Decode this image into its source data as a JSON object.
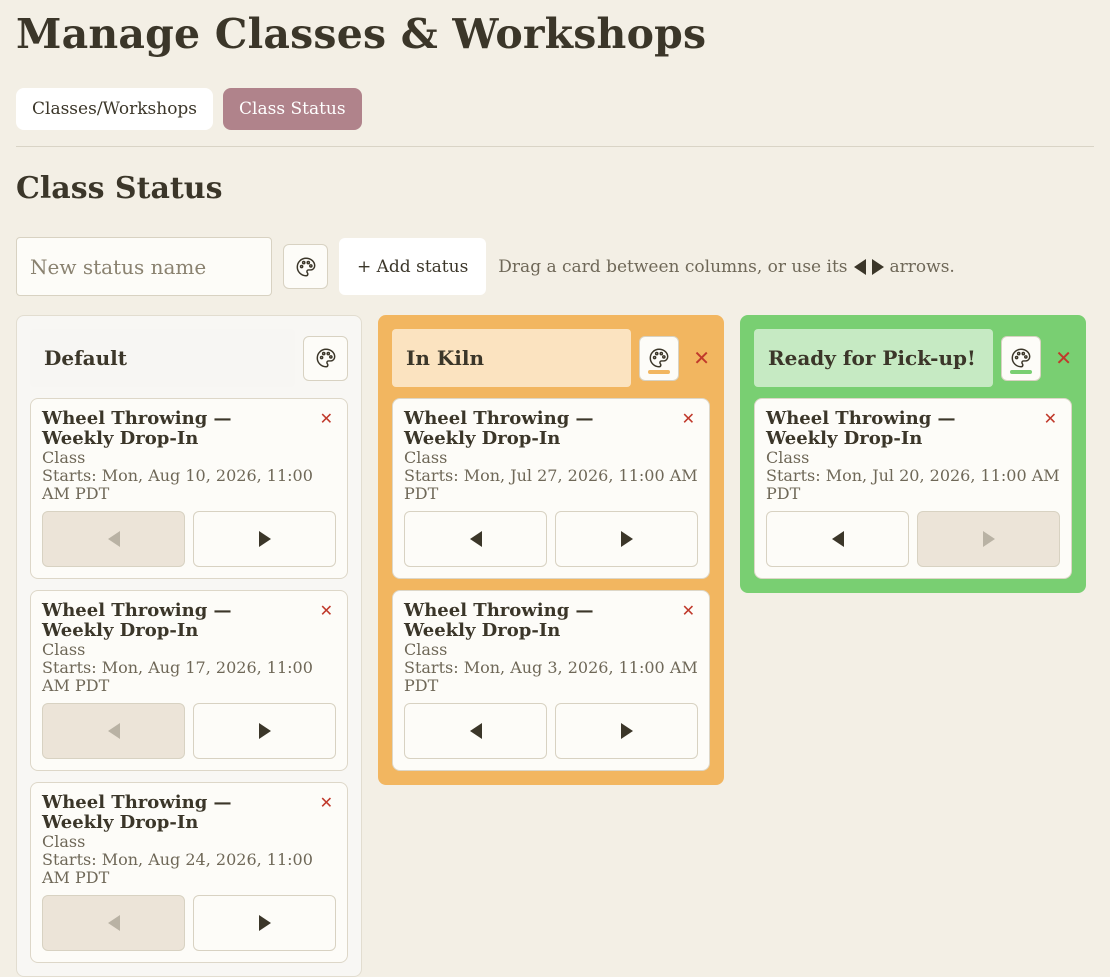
{
  "page": {
    "title": "Manage Classes & Workshops",
    "section_title": "Class Status"
  },
  "tabs": [
    {
      "label": "Classes/Workshops",
      "active": false
    },
    {
      "label": "Class Status",
      "active": true
    }
  ],
  "add_status": {
    "placeholder": "New status name",
    "button_label": "+ Add status",
    "hint_before": "Drag a card between columns, or use its",
    "hint_after": "arrows."
  },
  "columns": [
    {
      "title": "Default",
      "color": "#f8f7f4",
      "title_bg": "#f7f6f3",
      "swatch": "",
      "cards": [
        {
          "title": "Wheel Throwing — Weekly Drop-In",
          "type": "Class",
          "date": "Starts: Mon, Aug 10, 2026, 11:00 AM PDT",
          "left_disabled": true,
          "right_disabled": false
        },
        {
          "title": "Wheel Throwing — Weekly Drop-In",
          "type": "Class",
          "date": "Starts: Mon, Aug 17, 2026, 11:00 AM PDT",
          "left_disabled": true,
          "right_disabled": false
        },
        {
          "title": "Wheel Throwing — Weekly Drop-In",
          "type": "Class",
          "date": "Starts: Mon, Aug 24, 2026, 11:00 AM PDT",
          "left_disabled": true,
          "right_disabled": false
        }
      ]
    },
    {
      "title": "In Kiln",
      "color": "#f2b660",
      "title_bg": "#fbe3c0",
      "swatch": "#f2b660",
      "cards": [
        {
          "title": "Wheel Throwing — Weekly Drop-In",
          "type": "Class",
          "date": "Starts: Mon, Jul 27, 2026, 11:00 AM PDT",
          "left_disabled": false,
          "right_disabled": false
        },
        {
          "title": "Wheel Throwing — Weekly Drop-In",
          "type": "Class",
          "date": "Starts: Mon, Aug 3, 2026, 11:00 AM PDT",
          "left_disabled": false,
          "right_disabled": false
        }
      ]
    },
    {
      "title": "Ready for Pick-up!",
      "color": "#79cf72",
      "title_bg": "#c6eac3",
      "swatch": "#79cf72",
      "cards": [
        {
          "title": "Wheel Throwing — Weekly Drop-In",
          "type": "Class",
          "date": "Starts: Mon, Jul 20, 2026, 11:00 AM PDT",
          "left_disabled": false,
          "right_disabled": true
        }
      ]
    }
  ]
}
